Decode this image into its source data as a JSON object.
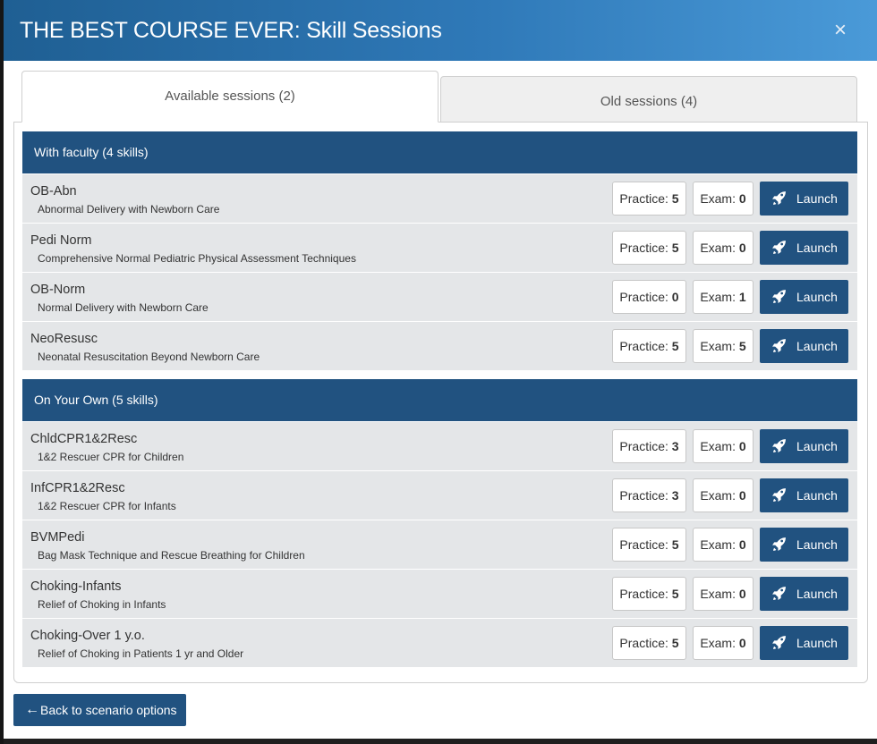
{
  "modal": {
    "title": "THE BEST COURSE EVER: Skill Sessions",
    "close_icon": "×"
  },
  "tabs": [
    {
      "label": "Available sessions (2)",
      "active": true
    },
    {
      "label": "Old sessions (4)",
      "active": false
    }
  ],
  "groups": [
    {
      "title": "With faculty (4 skills)",
      "skills": [
        {
          "name": "OB-Abn",
          "description": "Abnormal Delivery with Newborn Care",
          "practice": "5",
          "exam": "0"
        },
        {
          "name": "Pedi Norm",
          "description": "Comprehensive Normal Pediatric Physical Assessment Techniques",
          "practice": "5",
          "exam": "0"
        },
        {
          "name": "OB-Norm",
          "description": "Normal Delivery with Newborn Care",
          "practice": "0",
          "exam": "1"
        },
        {
          "name": "NeoResusc",
          "description": "Neonatal Resuscitation Beyond Newborn Care",
          "practice": "5",
          "exam": "5"
        }
      ]
    },
    {
      "title": "On Your Own (5 skills)",
      "skills": [
        {
          "name": "ChldCPR1&2Resc",
          "description": "1&2 Rescuer CPR for Children",
          "practice": "3",
          "exam": "0"
        },
        {
          "name": "InfCPR1&2Resc",
          "description": "1&2 Rescuer CPR for Infants",
          "practice": "3",
          "exam": "0"
        },
        {
          "name": "BVMPedi",
          "description": "Bag Mask Technique and Rescue Breathing for Children",
          "practice": "5",
          "exam": "0"
        },
        {
          "name": "Choking-Infants",
          "description": "Relief of Choking in Infants",
          "practice": "5",
          "exam": "0"
        },
        {
          "name": "Choking-Over 1 y.o.",
          "description": "Relief of Choking in Patients 1 yr and Older",
          "practice": "5",
          "exam": "0"
        }
      ]
    }
  ],
  "labels": {
    "practice": "Practice:",
    "exam": "Exam:",
    "launch": "Launch",
    "launch_icon": "rocket-icon"
  },
  "footer": {
    "back_label": "Back to scenario options",
    "back_icon": "arrow-left-icon"
  },
  "colors": {
    "primary": "#215280",
    "header_gradient_start": "#1f5f93",
    "header_gradient_end": "#4a9ad8",
    "row_background": "#e4e6e8"
  }
}
